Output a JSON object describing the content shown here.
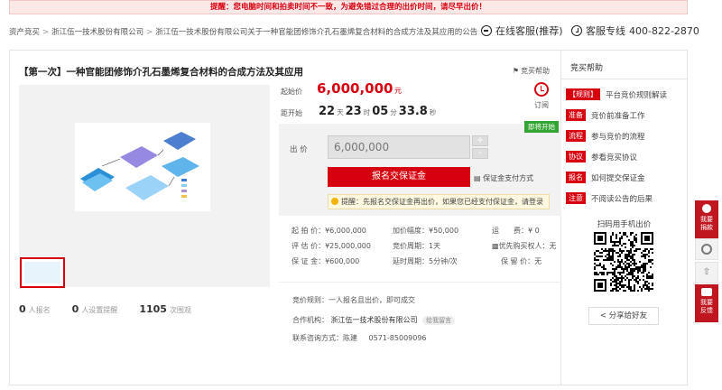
{
  "notice": "提醒：您电脑时间和拍卖时间不一致，为避免错过合理的出价时间，请尽早出价！",
  "breadcrumb": [
    "资产竞买",
    "浙江伍一技术股份有限公司",
    "浙江伍一技术股份有限公司关于一种官能团修饰介孔石墨烯复合材料的合成方法及其应用的公告"
  ],
  "header": {
    "service_label": "在线客服(推荐)",
    "hotline_label": "客服专线",
    "hotline_number": "400-822-2870"
  },
  "item": {
    "title": "【第一次】一种官能团修饰介孔石墨烯复合材料的合成方法及其应用",
    "help_label": "竞买帮助"
  },
  "pricing": {
    "start_label": "起始价",
    "start_value": "6,000,000",
    "start_unit": "元",
    "countdown_label": "距开始",
    "days": "22",
    "days_unit": "天",
    "hours": "23",
    "hours_unit": "时",
    "minutes": "05",
    "minutes_unit": "分",
    "seconds": "33.8",
    "seconds_unit": "秒",
    "remind_label": "订阅"
  },
  "bid": {
    "status_tag": "即将开始",
    "label": "出 价",
    "value": "6,000,000",
    "plus": "+",
    "minus": "-",
    "deposit_button": "报名交保证金",
    "pay_method_link": "保证金支付方式",
    "tip": "提醒：先报名交保证金再出价，如果您已经支付保证金，请登录"
  },
  "details": {
    "start_price": "起 拍 价：¥6,000,000",
    "increment": "加价幅度：¥50,000",
    "shipping": "运　　费：¥ 0",
    "valuation": "评 估 价：¥25,000,000",
    "cycle": "竞价周期：1天",
    "priority": "优先购买权人：无",
    "deposit": "保 证 金：¥600,000",
    "delay": "延时周期：5分钟/次",
    "retention": "保 留 价：无"
  },
  "rules": {
    "bid_rule": "竞价规则：一人报名且出价，即可成交",
    "partner_label": "合作机构：",
    "partner_name": "浙江伍一技术股份有限公司",
    "partner_badge": "给我留言",
    "contact_label": "联系咨询方式：陈建",
    "contact_phone": "0571-85009096"
  },
  "stats": [
    {
      "count": "0",
      "label": "人报名"
    },
    {
      "count": "0",
      "label": "人设置提醒"
    },
    {
      "count": "1105",
      "label": "次围观"
    }
  ],
  "help_panel": {
    "title": "竞买帮助",
    "items": [
      {
        "tag": "【规则】",
        "label": "平台竞价规则解读"
      },
      {
        "tag": "准备",
        "label": "竞价前准备工作"
      },
      {
        "tag": "流程",
        "label": "参与竞价的流程"
      },
      {
        "tag": "协议",
        "label": "参看竞买协议"
      },
      {
        "tag": "报名",
        "label": "如何提交保证金"
      },
      {
        "tag": "注意",
        "label": "不阅读公告的后果"
      }
    ],
    "qr_label": "扫码用手机出价",
    "share_button": "分享给好友"
  },
  "float_bar": {
    "deposit_label": "我要\n捐款",
    "feedback_label": "我要\n反馈"
  },
  "colors": {
    "accent": "#d7000f",
    "tag_green": "#33a532"
  }
}
